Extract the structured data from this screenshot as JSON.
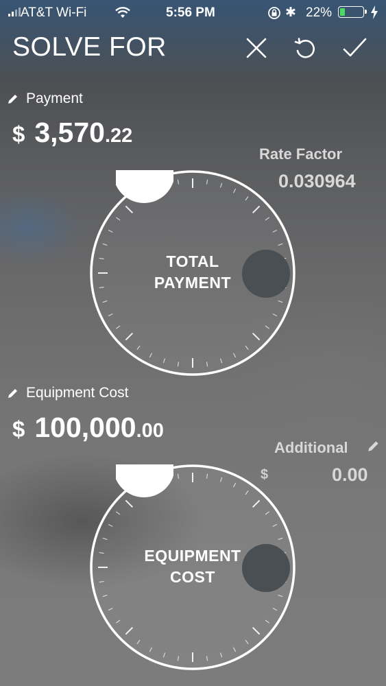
{
  "status_bar": {
    "carrier": "AT&T Wi-Fi",
    "time": "5:56 PM",
    "battery_percent": "22%",
    "battery_level": 0.22,
    "icons": [
      "signal-bars-icon",
      "wifi-icon",
      "rotation-lock-icon",
      "bluetooth-icon",
      "battery-icon",
      "charging-bolt-icon"
    ]
  },
  "nav": {
    "title": "SOLVE FOR",
    "buttons": [
      "close-icon",
      "reset-icon",
      "check-icon"
    ]
  },
  "payment": {
    "label": "Payment",
    "currency": "$",
    "whole": "3,570",
    "fraction": ".22"
  },
  "rate_factor": {
    "label": "Rate Factor",
    "value": "0.030964"
  },
  "total_payment_dial": {
    "line1": "TOTAL",
    "line2": "PAYMENT"
  },
  "equipment_cost": {
    "label": "Equipment Cost",
    "currency": "$",
    "whole": "100,000",
    "fraction": ".00"
  },
  "additional": {
    "label": "Additional",
    "currency": "$",
    "value": "0.00"
  },
  "equipment_cost_dial": {
    "line1": "EQUIPMENT",
    "line2": "COST"
  },
  "colors": {
    "knob": "#4a4f53",
    "ring": "#ffffff",
    "battery_fill": "#4cd964"
  }
}
